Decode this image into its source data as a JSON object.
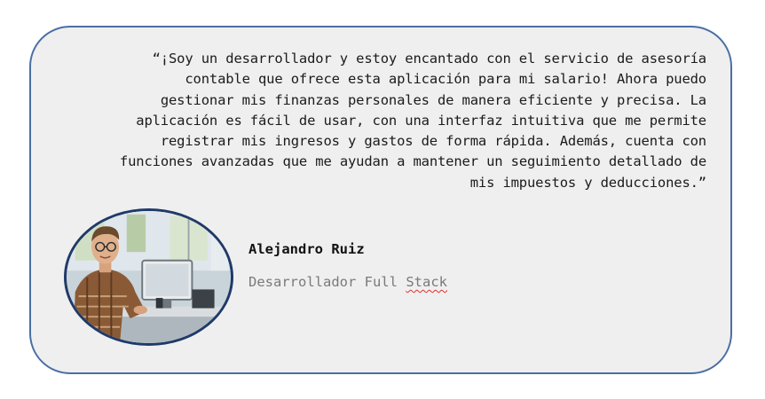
{
  "testimonial": {
    "quote_lines": [
      "“¡Soy un desarrollador y estoy encantado con el servicio de asesoría",
      "contable que ofrece esta aplicación para mi salario! Ahora puedo",
      "gestionar mis finanzas personales de manera eficiente y precisa. La",
      "aplicación es fácil de usar, con una interfaz intuitiva que me permite",
      "registrar mis ingresos y gastos de forma rápida. Además, cuenta con",
      "funciones avanzadas que me ayudan a mantener un seguimiento detallado de",
      "mis impuestos y deducciones.”"
    ],
    "author_name": "Alejandro Ruiz",
    "author_role_prefix": "Desarrollador Full",
    "author_role_flagged": "Stack"
  },
  "colors": {
    "card_background": "#efefef",
    "card_border": "#4a6fa5",
    "avatar_border": "#1f3a68",
    "spellcheck_underline": "#e03030"
  }
}
